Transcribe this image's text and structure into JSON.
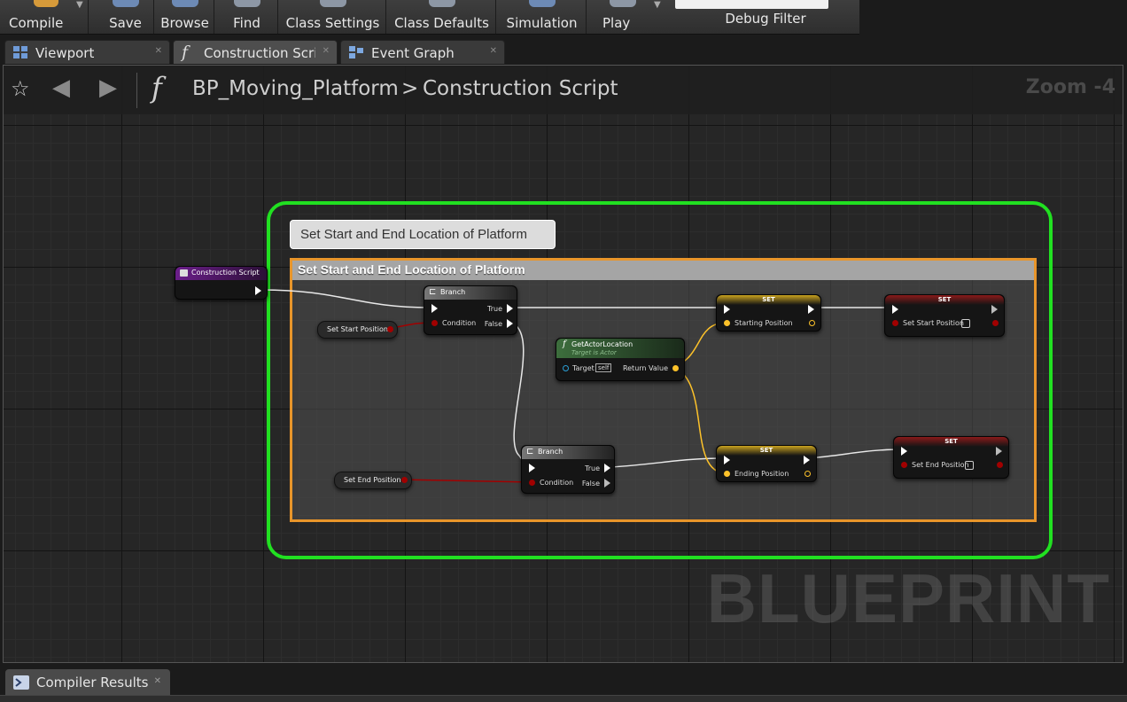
{
  "toolbar": {
    "buttons": [
      {
        "label": "Compile"
      },
      {
        "label": "Save"
      },
      {
        "label": "Browse"
      },
      {
        "label": "Find"
      },
      {
        "label": "Class Settings"
      },
      {
        "label": "Class Defaults"
      },
      {
        "label": "Simulation"
      },
      {
        "label": "Play"
      }
    ],
    "debug_filter_label": "Debug Filter"
  },
  "tabs": [
    {
      "label": "Viewport",
      "icon": "viewport-icon"
    },
    {
      "label": "Construction Script",
      "icon": "function-icon",
      "active": true
    },
    {
      "label": "Event Graph",
      "icon": "event-graph-icon"
    }
  ],
  "breadcrumb": {
    "blueprint": "BP_Moving_Platform",
    "separator": ">",
    "graph": "Construction Script",
    "zoom": "Zoom -4"
  },
  "graph": {
    "comment_bubble": "Set Start and End Location of Platform",
    "comment_title": "Set Start and End Location of Platform",
    "watermark": "BLUEPRINT",
    "colors": {
      "highlight_frame": "#21e021",
      "comment_border": "#e8952a",
      "bool_pin": "#a10000",
      "vector_pin": "#fdc22a",
      "object_pin": "#2a9fd6"
    },
    "nodes": {
      "construction_script": {
        "title": "Construction Script"
      },
      "branch1": {
        "title": "Branch",
        "true_label": "True",
        "false_label": "False",
        "condition_label": "Condition"
      },
      "branch2": {
        "title": "Branch",
        "true_label": "True",
        "false_label": "False",
        "condition_label": "Condition"
      },
      "set_start_var": {
        "label": "Set Start Position"
      },
      "set_end_var": {
        "label": "Set End Position"
      },
      "get_actor_location": {
        "title": "GetActorLocation",
        "subtitle": "Target is Actor",
        "target_label": "Target",
        "self_label": "self",
        "return_label": "Return Value"
      },
      "set_starting": {
        "title": "SET",
        "pin_label": "Starting Position"
      },
      "set_ending": {
        "title": "SET",
        "pin_label": "Ending Position"
      },
      "set_start_bool": {
        "title": "SET",
        "pin_label": "Set Start Position"
      },
      "set_end_bool": {
        "title": "SET",
        "pin_label": "Set End Position"
      }
    }
  },
  "bottom": {
    "tab_label": "Compiler Results"
  }
}
